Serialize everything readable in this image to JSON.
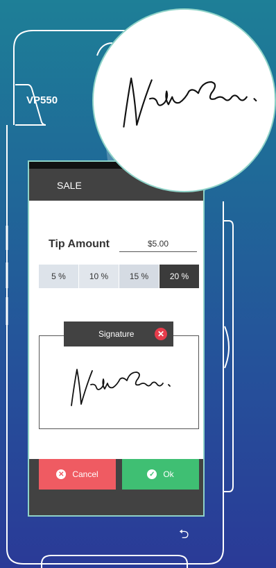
{
  "device": {
    "model": "VP550"
  },
  "screen": {
    "header_title": "SALE",
    "tip": {
      "label": "Tip Amount",
      "value": "$5.00"
    },
    "tip_options": [
      {
        "label": "5 %",
        "selected": false
      },
      {
        "label": "10 %",
        "selected": false
      },
      {
        "label": "15 %",
        "selected": false
      },
      {
        "label": "20 %",
        "selected": true
      }
    ],
    "signature": {
      "label": "Signature",
      "close_icon": "close-icon"
    },
    "actions": {
      "cancel_label": "Cancel",
      "ok_label": "Ok"
    }
  },
  "colors": {
    "cancel": "#ef5b62",
    "ok": "#3fbf73",
    "close": "#e63c4b",
    "header": "#424242"
  },
  "icons": [
    "back-icon",
    "cancel-icon",
    "check-icon",
    "close-icon"
  ]
}
